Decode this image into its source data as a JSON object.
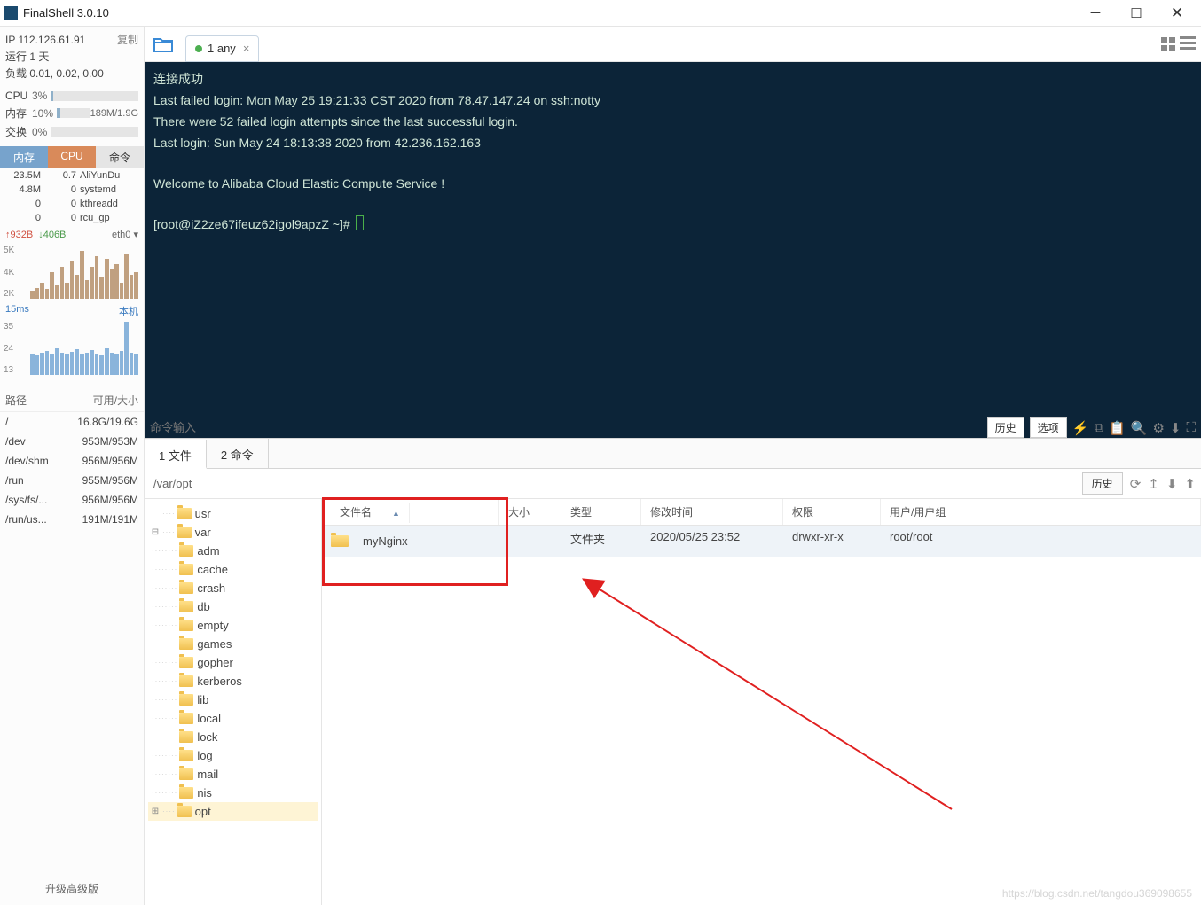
{
  "app": {
    "title": "FinalShell 3.0.10"
  },
  "sidebar": {
    "ip": "IP 112.126.61.91",
    "copy": "复制",
    "uptime": "运行 1 天",
    "load": "负载 0.01, 0.02, 0.00",
    "metrics": {
      "cpu_label": "CPU",
      "cpu_val": "3%",
      "mem_label": "内存",
      "mem_val": "10%",
      "mem_extra": "189M/1.9G",
      "swap_label": "交换",
      "swap_val": "0%"
    },
    "proc_headers": {
      "h1": "内存",
      "h2": "CPU",
      "h3": "命令"
    },
    "procs": [
      {
        "m": "23.5M",
        "c": "0.7",
        "cmd": "AliYunDu"
      },
      {
        "m": "4.8M",
        "c": "0",
        "cmd": "systemd"
      },
      {
        "m": "0",
        "c": "0",
        "cmd": "kthreadd"
      },
      {
        "m": "0",
        "c": "0",
        "cmd": "rcu_gp"
      }
    ],
    "net": {
      "up": "↑932B",
      "down": "↓406B",
      "iface": "eth0 ▾"
    },
    "net_y": [
      "5K",
      "4K",
      "2K"
    ],
    "ping": {
      "ms": "15ms",
      "host": "本机"
    },
    "ping_y": [
      "35",
      "24",
      "13"
    ],
    "fs_header": {
      "path": "路径",
      "size": "可用/大小"
    },
    "fs": [
      {
        "p": "/",
        "s": "16.8G/19.6G"
      },
      {
        "p": "/dev",
        "s": "953M/953M"
      },
      {
        "p": "/dev/shm",
        "s": "956M/956M"
      },
      {
        "p": "/run",
        "s": "955M/956M"
      },
      {
        "p": "/sys/fs/...",
        "s": "956M/956M"
      },
      {
        "p": "/run/us...",
        "s": "191M/191M"
      }
    ],
    "upgrade": "升级高级版"
  },
  "tab": {
    "label": "1 any"
  },
  "terminal": {
    "l1": "连接成功",
    "l2": "Last failed login: Mon May 25 19:21:33 CST 2020 from 78.47.147.24 on ssh:notty",
    "l3": "There were 52 failed login attempts since the last successful login.",
    "l4": "Last login: Sun May 24 18:13:38 2020 from 42.236.162.163",
    "l5": "Welcome to Alibaba Cloud Elastic Compute Service !",
    "l6": "[root@iZ2ze67ifeuz62igol9apzZ ~]# ",
    "input_placeholder": "命令输入",
    "btn_history": "历史",
    "btn_options": "选项"
  },
  "lower": {
    "tab_file": "1 文件",
    "tab_cmd": "2 命令",
    "path": "/var/opt",
    "btn_history": "历史",
    "tree": {
      "usr": "usr",
      "var": "var",
      "adm": "adm",
      "cache": "cache",
      "crash": "crash",
      "db": "db",
      "empty": "empty",
      "games": "games",
      "gopher": "gopher",
      "kerberos": "kerberos",
      "lib": "lib",
      "local": "local",
      "lock": "lock",
      "log": "log",
      "mail": "mail",
      "nis": "nis",
      "opt": "opt"
    },
    "cols": {
      "name": "文件名",
      "size": "大小",
      "type": "类型",
      "mtime": "修改时间",
      "perm": "权限",
      "owner": "用户/用户组"
    },
    "row": {
      "name": "myNginx",
      "type": "文件夹",
      "mtime": "2020/05/25 23:52",
      "perm": "drwxr-xr-x",
      "owner": "root/root"
    }
  },
  "watermark": "https://blog.csdn.net/tangdou369098655"
}
